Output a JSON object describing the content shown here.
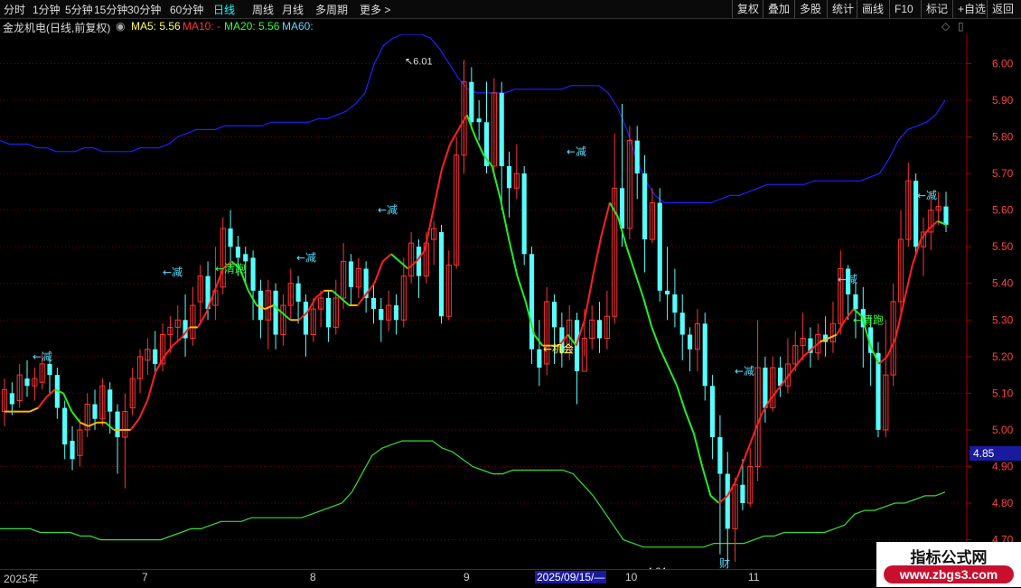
{
  "toolbar": {
    "periods": [
      "分时",
      "1分钟",
      "5分钟",
      "15分钟",
      "30分钟",
      "60分钟",
      "日线",
      "周线",
      "月线",
      "多周期",
      "更多 >"
    ],
    "active_period": "日线",
    "right_buttons": [
      "复权",
      "叠加",
      "多股",
      "统计",
      "画线",
      "F10",
      "标记",
      "+自选",
      "返回"
    ]
  },
  "infobar": {
    "title": "金龙机电(日线,前复权)",
    "ma5": "MA5: 5.56",
    "ma10": "MA10: -",
    "ma20": "MA20: 5.56",
    "ma60": "MA60:",
    "colors": {
      "ma5": "#ffff55",
      "ma10": "#ff3333",
      "ma20": "#33ff33",
      "ma60": "#55ddff"
    }
  },
  "price_tag": "4.85",
  "watermark": {
    "line1": "指标公式网",
    "line2": "www.zbgs3.com"
  },
  "time_axis": [
    "2025年",
    "7",
    "8",
    "9",
    "2025/09/15/—",
    "10",
    "11"
  ],
  "marker_cai": "财",
  "chart_data": {
    "type": "candlestick",
    "ylim": [
      4.62,
      6.08
    ],
    "y_ticks": [
      "6.00",
      "5.90",
      "5.80",
      "5.70",
      "5.60",
      "5.50",
      "5.40",
      "5.30",
      "5.20",
      "5.10",
      "5.00",
      "4.90",
      "4.80",
      "4.70"
    ],
    "high_label": "6.01",
    "low_label": "4.64",
    "annotations": [
      {
        "text": "←减",
        "x": 36,
        "y": 5.2,
        "color": "#55ddff"
      },
      {
        "text": "←减",
        "x": 180,
        "y": 5.43,
        "color": "#55ddff"
      },
      {
        "text": "←清跑",
        "x": 238,
        "y": 5.44,
        "color": "#33ff33"
      },
      {
        "text": "←减",
        "x": 328,
        "y": 5.47,
        "color": "#55ddff"
      },
      {
        "text": "←减",
        "x": 418,
        "y": 5.6,
        "color": "#55ddff"
      },
      {
        "text": "←减",
        "x": 627,
        "y": 5.76,
        "color": "#55ddff"
      },
      {
        "text": "←机会",
        "x": 601,
        "y": 5.22,
        "color": "#ffff55"
      },
      {
        "text": "←减",
        "x": 813,
        "y": 5.16,
        "color": "#55ddff"
      },
      {
        "text": "←减",
        "x": 927,
        "y": 5.41,
        "color": "#55ddff"
      },
      {
        "text": "←清跑",
        "x": 944,
        "y": 5.3,
        "color": "#33ff33"
      },
      {
        "text": "←减",
        "x": 1015,
        "y": 5.64,
        "color": "#55ddff"
      }
    ],
    "upper_band": [
      5.79,
      5.78,
      5.78,
      5.78,
      5.77,
      5.77,
      5.76,
      5.76,
      5.76,
      5.77,
      5.77,
      5.76,
      5.76,
      5.76,
      5.76,
      5.77,
      5.77,
      5.77,
      5.78,
      5.8,
      5.81,
      5.82,
      5.82,
      5.82,
      5.83,
      5.83,
      5.83,
      5.83,
      5.83,
      5.84,
      5.84,
      5.84,
      5.84,
      5.84,
      5.85,
      5.85,
      5.86,
      5.87,
      5.89,
      5.92,
      6.0,
      6.05,
      6.07,
      6.08,
      6.08,
      6.08,
      6.07,
      6.04,
      6.0,
      5.96,
      5.93,
      5.92,
      5.92,
      5.92,
      5.92,
      5.93,
      5.93,
      5.93,
      5.93,
      5.93,
      5.93,
      5.94,
      5.94,
      5.94,
      5.94,
      5.92,
      5.88,
      5.82,
      5.74,
      5.68,
      5.64,
      5.62,
      5.62,
      5.62,
      5.62,
      5.62,
      5.62,
      5.63,
      5.64,
      5.64,
      5.65,
      5.66,
      5.67,
      5.67,
      5.67,
      5.67,
      5.67,
      5.68,
      5.68,
      5.68,
      5.68,
      5.68,
      5.68,
      5.69,
      5.7,
      5.74,
      5.79,
      5.82,
      5.83,
      5.84,
      5.86,
      5.9
    ],
    "lower_band": [
      4.73,
      4.73,
      4.73,
      4.73,
      4.72,
      4.72,
      4.72,
      4.72,
      4.71,
      4.71,
      4.7,
      4.7,
      4.7,
      4.7,
      4.7,
      4.7,
      4.7,
      4.71,
      4.72,
      4.73,
      4.73,
      4.74,
      4.75,
      4.75,
      4.75,
      4.76,
      4.76,
      4.76,
      4.76,
      4.76,
      4.76,
      4.77,
      4.78,
      4.79,
      4.8,
      4.83,
      4.88,
      4.93,
      4.95,
      4.96,
      4.97,
      4.97,
      4.97,
      4.97,
      4.95,
      4.94,
      4.92,
      4.9,
      4.89,
      4.88,
      4.88,
      4.89,
      4.89,
      4.89,
      4.89,
      4.89,
      4.89,
      4.88,
      4.85,
      4.82,
      4.78,
      4.74,
      4.7,
      4.69,
      4.68,
      4.68,
      4.68,
      4.68,
      4.68,
      4.68,
      4.68,
      4.69,
      4.69,
      4.69,
      4.69,
      4.7,
      4.71,
      4.71,
      4.72,
      4.72,
      4.72,
      4.72,
      4.72,
      4.73,
      4.74,
      4.77,
      4.78,
      4.78,
      4.79,
      4.8,
      4.8,
      4.81,
      4.82,
      4.82,
      4.83
    ],
    "ma_line": [
      5.05,
      5.05,
      5.05,
      5.05,
      5.06,
      5.09,
      5.11,
      5.1,
      5.05,
      5.02,
      5.01,
      5.02,
      5.02,
      5.0,
      5.0,
      5.0,
      5.03,
      5.08,
      5.16,
      5.2,
      5.23,
      5.25,
      5.28,
      5.28,
      5.32,
      5.38,
      5.44,
      5.46,
      5.44,
      5.38,
      5.34,
      5.33,
      5.34,
      5.32,
      5.3,
      5.3,
      5.32,
      5.36,
      5.38,
      5.38,
      5.36,
      5.34,
      5.34,
      5.37,
      5.4,
      5.46,
      5.48,
      5.46,
      5.44,
      5.46,
      5.49,
      5.6,
      5.71,
      5.78,
      5.82,
      5.86,
      5.8,
      5.75,
      5.72,
      5.63,
      5.52,
      5.42,
      5.35,
      5.26,
      5.23,
      5.23,
      5.23,
      5.26,
      5.23,
      5.3,
      5.42,
      5.53,
      5.62,
      5.58,
      5.5,
      5.43,
      5.36,
      5.28,
      5.22,
      5.17,
      5.12,
      5.05,
      4.99,
      4.9,
      4.82,
      4.8,
      4.82,
      4.86,
      4.92,
      4.98,
      5.04,
      5.08,
      5.11,
      5.14,
      5.17,
      5.2,
      5.22,
      5.24,
      5.25,
      5.26,
      5.3,
      5.33,
      5.31,
      5.23,
      5.18,
      5.2,
      5.25,
      5.35,
      5.45,
      5.52,
      5.55,
      5.57,
      5.56
    ],
    "candles": [
      [
        5.05,
        5.11,
        5.14,
        5.01
      ],
      [
        5.1,
        5.07,
        5.13,
        5.04
      ],
      [
        5.08,
        5.15,
        5.18,
        5.06
      ],
      [
        5.14,
        5.12,
        5.19,
        5.09
      ],
      [
        5.12,
        5.14,
        5.17,
        5.08
      ],
      [
        5.13,
        5.18,
        5.21,
        5.11
      ],
      [
        5.18,
        5.15,
        5.2,
        5.1
      ],
      [
        5.15,
        5.06,
        5.17,
        5.03
      ],
      [
        5.06,
        4.96,
        5.08,
        4.92
      ],
      [
        4.97,
        4.92,
        5.01,
        4.89
      ],
      [
        4.93,
        5.0,
        5.03,
        4.9
      ],
      [
        5.0,
        5.07,
        5.1,
        4.98
      ],
      [
        5.07,
        5.03,
        5.11,
        5.0
      ],
      [
        5.03,
        5.12,
        5.14,
        5.01
      ],
      [
        5.11,
        5.05,
        5.13,
        4.99
      ],
      [
        5.05,
        4.98,
        5.07,
        4.88
      ],
      [
        4.98,
        5.05,
        5.1,
        4.84
      ],
      [
        5.06,
        5.14,
        5.17,
        5.04
      ],
      [
        5.14,
        5.2,
        5.22,
        5.1
      ],
      [
        5.19,
        5.22,
        5.25,
        5.15
      ],
      [
        5.22,
        5.18,
        5.27,
        5.15
      ],
      [
        5.18,
        5.26,
        5.29,
        5.16
      ],
      [
        5.26,
        5.28,
        5.31,
        5.21
      ],
      [
        5.28,
        5.3,
        5.34,
        5.24
      ],
      [
        5.3,
        5.25,
        5.37,
        5.2
      ],
      [
        5.25,
        5.34,
        5.39,
        5.23
      ],
      [
        5.35,
        5.42,
        5.45,
        5.29
      ],
      [
        5.42,
        5.33,
        5.46,
        5.3
      ],
      [
        5.34,
        5.38,
        5.5,
        5.3
      ],
      [
        5.39,
        5.55,
        5.58,
        5.37
      ],
      [
        5.55,
        5.5,
        5.6,
        5.44
      ],
      [
        5.5,
        5.47,
        5.53,
        5.42
      ],
      [
        5.48,
        5.46,
        5.5,
        5.4
      ],
      [
        5.47,
        5.38,
        5.49,
        5.3
      ],
      [
        5.38,
        5.3,
        5.41,
        5.25
      ],
      [
        5.3,
        5.38,
        5.41,
        5.22
      ],
      [
        5.38,
        5.26,
        5.4,
        5.22
      ],
      [
        5.26,
        5.34,
        5.37,
        5.23
      ],
      [
        5.34,
        5.4,
        5.44,
        5.3
      ],
      [
        5.4,
        5.35,
        5.42,
        5.29
      ],
      [
        5.35,
        5.26,
        5.37,
        5.2
      ],
      [
        5.26,
        5.33,
        5.36,
        5.24
      ],
      [
        5.33,
        5.36,
        5.38,
        5.28
      ],
      [
        5.36,
        5.28,
        5.38,
        5.24
      ],
      [
        5.28,
        5.36,
        5.41,
        5.26
      ],
      [
        5.36,
        5.46,
        5.51,
        5.33
      ],
      [
        5.46,
        5.39,
        5.48,
        5.34
      ],
      [
        5.39,
        5.44,
        5.47,
        5.36
      ],
      [
        5.44,
        5.36,
        5.46,
        5.32
      ],
      [
        5.36,
        5.33,
        5.4,
        5.29
      ],
      [
        5.33,
        5.3,
        5.36,
        5.24
      ],
      [
        5.3,
        5.34,
        5.38,
        5.27
      ],
      [
        5.34,
        5.3,
        5.37,
        5.26
      ],
      [
        5.3,
        5.42,
        5.47,
        5.28
      ],
      [
        5.42,
        5.51,
        5.54,
        5.4
      ],
      [
        5.5,
        5.42,
        5.52,
        5.36
      ],
      [
        5.42,
        5.51,
        5.54,
        5.4
      ],
      [
        5.52,
        5.55,
        5.57,
        5.45
      ],
      [
        5.54,
        5.31,
        5.56,
        5.29
      ],
      [
        5.31,
        5.45,
        5.49,
        5.3
      ],
      [
        5.45,
        5.75,
        5.8,
        5.44
      ],
      [
        5.75,
        5.95,
        6.01,
        5.7
      ],
      [
        5.95,
        5.84,
        5.99,
        5.82
      ],
      [
        5.85,
        5.84,
        5.9,
        5.79
      ],
      [
        5.84,
        5.72,
        5.95,
        5.7
      ],
      [
        5.72,
        5.92,
        5.96,
        5.69
      ],
      [
        5.92,
        5.72,
        5.95,
        5.6
      ],
      [
        5.72,
        5.66,
        5.76,
        5.58
      ],
      [
        5.66,
        5.7,
        5.78,
        5.63
      ],
      [
        5.7,
        5.48,
        5.72,
        5.45
      ],
      [
        5.48,
        5.22,
        5.5,
        5.18
      ],
      [
        5.22,
        5.17,
        5.3,
        5.12
      ],
      [
        5.18,
        5.35,
        5.39,
        5.15
      ],
      [
        5.35,
        5.28,
        5.37,
        5.18
      ],
      [
        5.28,
        5.21,
        5.32,
        5.17
      ],
      [
        5.21,
        5.3,
        5.34,
        5.19
      ],
      [
        5.3,
        5.16,
        5.32,
        5.07
      ],
      [
        5.16,
        5.25,
        5.33,
        5.2
      ],
      [
        5.25,
        5.3,
        5.34,
        5.22
      ],
      [
        5.3,
        5.25,
        5.35,
        5.21
      ],
      [
        5.25,
        5.31,
        5.38,
        5.22
      ],
      [
        5.31,
        5.66,
        5.81,
        5.29
      ],
      [
        5.66,
        5.55,
        5.89,
        5.5
      ],
      [
        5.55,
        5.79,
        5.83,
        5.52
      ],
      [
        5.79,
        5.7,
        5.83,
        5.63
      ],
      [
        5.7,
        5.52,
        5.75,
        5.43
      ],
      [
        5.52,
        5.62,
        5.66,
        5.51
      ],
      [
        5.62,
        5.38,
        5.66,
        5.35
      ],
      [
        5.38,
        5.37,
        5.5,
        5.3
      ],
      [
        5.37,
        5.32,
        5.44,
        5.28
      ],
      [
        5.32,
        5.26,
        5.37,
        5.19
      ],
      [
        5.26,
        5.22,
        5.28,
        5.16
      ],
      [
        5.22,
        5.29,
        5.33,
        5.16
      ],
      [
        5.29,
        5.12,
        5.32,
        5.08
      ],
      [
        5.12,
        4.98,
        5.15,
        4.92
      ],
      [
        4.98,
        4.88,
        5.04,
        4.66
      ],
      [
        4.88,
        4.73,
        4.94,
        4.64
      ],
      [
        4.73,
        4.85,
        4.87,
        4.64
      ],
      [
        4.85,
        4.8,
        4.92,
        4.78
      ],
      [
        4.8,
        4.9,
        4.95,
        4.79
      ],
      [
        4.9,
        5.17,
        5.3,
        4.86
      ],
      [
        5.17,
        5.06,
        5.2,
        5.02
      ],
      [
        5.06,
        5.17,
        5.2,
        5.05
      ],
      [
        5.17,
        5.12,
        5.2,
        5.09
      ],
      [
        5.12,
        5.18,
        5.25,
        5.1
      ],
      [
        5.18,
        5.23,
        5.27,
        5.16
      ],
      [
        5.23,
        5.25,
        5.32,
        5.19
      ],
      [
        5.25,
        5.21,
        5.28,
        5.17
      ],
      [
        5.21,
        5.26,
        5.29,
        5.19
      ],
      [
        5.26,
        5.24,
        5.31,
        5.2
      ],
      [
        5.24,
        5.29,
        5.35,
        5.21
      ],
      [
        5.29,
        5.44,
        5.49,
        5.26
      ],
      [
        5.44,
        5.37,
        5.45,
        5.3
      ],
      [
        5.37,
        5.33,
        5.4,
        5.25
      ],
      [
        5.33,
        5.28,
        5.39,
        5.17
      ],
      [
        5.28,
        5.21,
        5.31,
        5.12
      ],
      [
        5.21,
        5.0,
        5.24,
        4.98
      ],
      [
        5.0,
        5.15,
        5.3,
        4.98
      ],
      [
        5.15,
        5.35,
        5.4,
        5.12
      ],
      [
        5.35,
        5.52,
        5.6,
        5.32
      ],
      [
        5.52,
        5.68,
        5.73,
        5.5
      ],
      [
        5.68,
        5.5,
        5.7,
        5.48
      ],
      [
        5.5,
        5.54,
        5.58,
        5.42
      ],
      [
        5.54,
        5.6,
        5.65,
        5.49
      ],
      [
        5.6,
        5.61,
        5.65,
        5.56
      ],
      [
        5.61,
        5.56,
        5.65,
        5.54
      ]
    ]
  }
}
